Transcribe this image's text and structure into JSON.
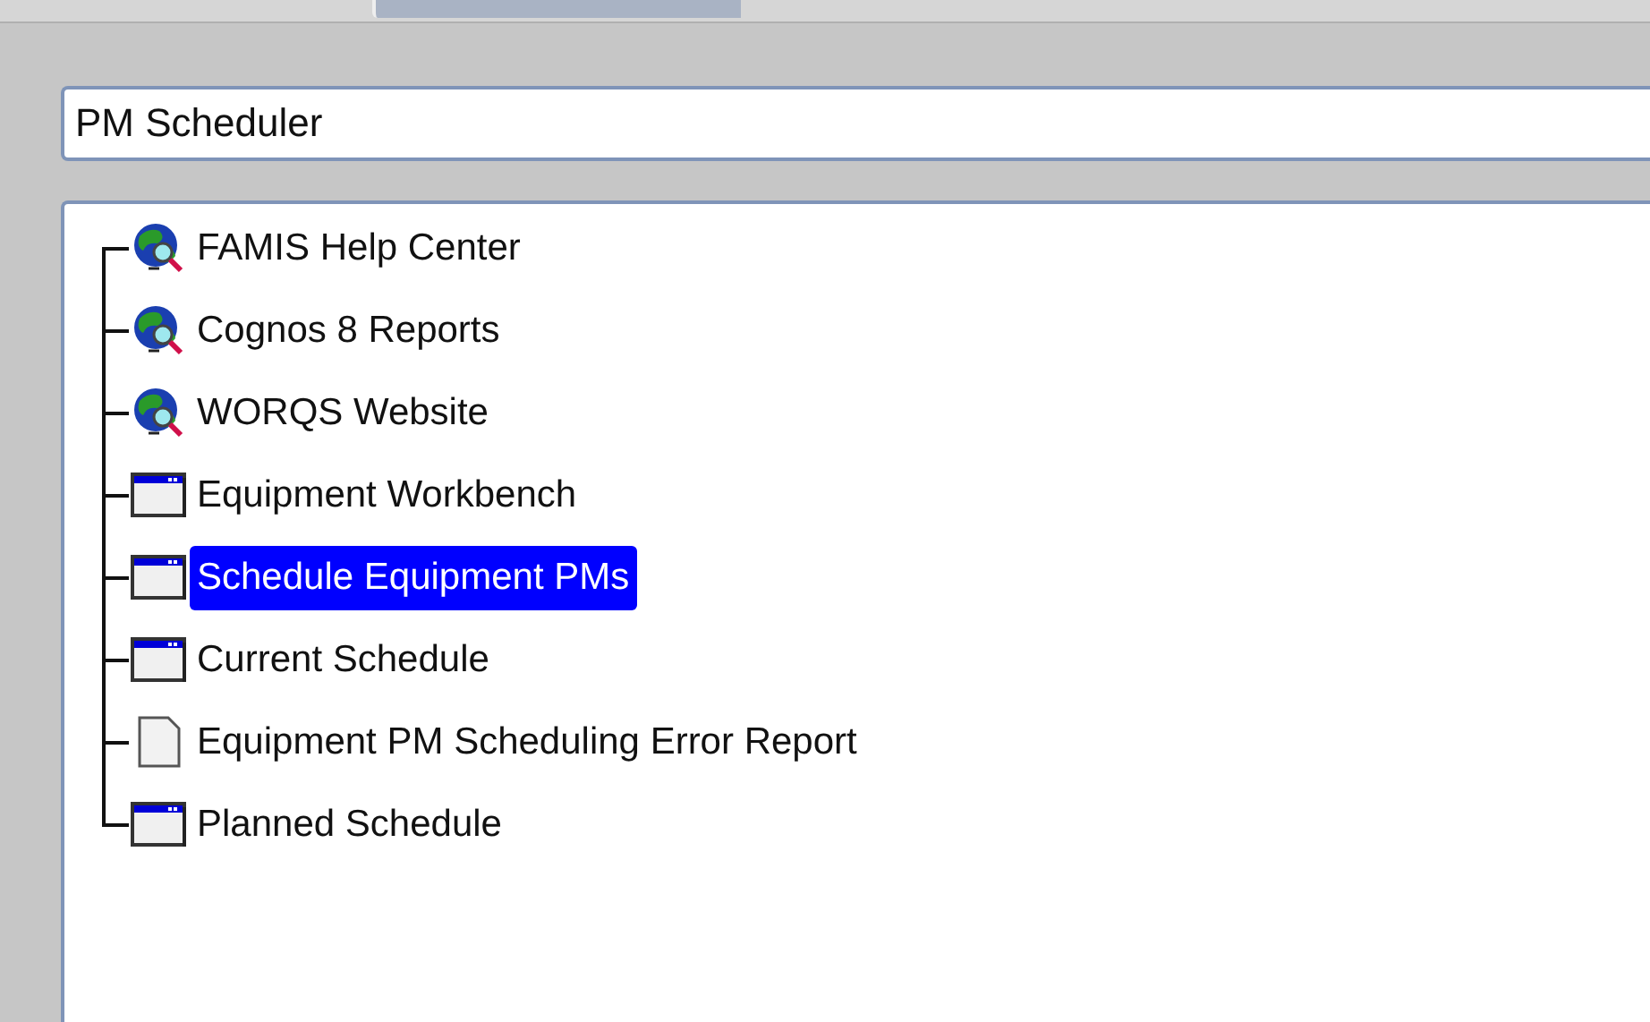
{
  "title_field": {
    "value": "PM Scheduler"
  },
  "tree": {
    "items": [
      {
        "label": "FAMIS Help Center",
        "kind": "web",
        "selected": false
      },
      {
        "label": "Cognos 8 Reports",
        "kind": "web",
        "selected": false
      },
      {
        "label": "WORQS Website",
        "kind": "web",
        "selected": false
      },
      {
        "label": "Equipment Workbench",
        "kind": "form",
        "selected": false
      },
      {
        "label": "Schedule Equipment PMs",
        "kind": "form",
        "selected": true
      },
      {
        "label": "Current Schedule",
        "kind": "form",
        "selected": false
      },
      {
        "label": "Equipment PM Scheduling Error Report",
        "kind": "report",
        "selected": false
      },
      {
        "label": "Planned Schedule",
        "kind": "form",
        "selected": false
      }
    ]
  }
}
